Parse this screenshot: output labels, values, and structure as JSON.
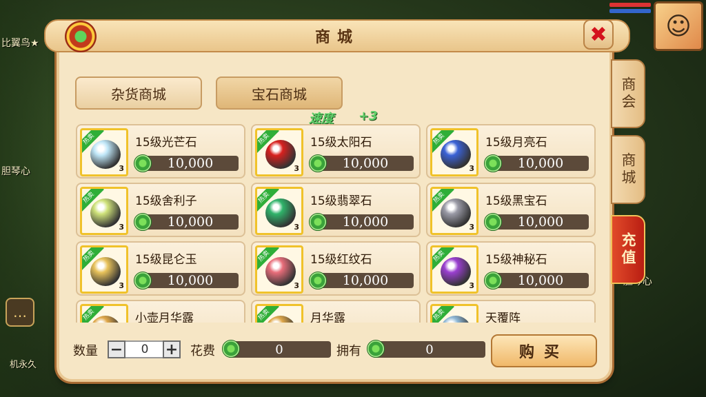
{
  "background": {
    "player_names": [
      "比翼鸟★",
      "胆琴心",
      "胆琴心"
    ],
    "chat_line": "机永久"
  },
  "window": {
    "title": "商城",
    "close_icon": "close-icon"
  },
  "side_tabs": [
    {
      "label": "商会"
    },
    {
      "label": "商城"
    },
    {
      "label": "充值"
    }
  ],
  "category_tabs": [
    {
      "label": "杂货商城"
    },
    {
      "label": "宝石商城"
    }
  ],
  "floating_text": {
    "stat": "速度",
    "bonus": "+3"
  },
  "hot_tag": "热卖",
  "items": [
    {
      "name": "15级光芒石",
      "price": "10,000",
      "count": "3",
      "color": "#bfe6f7"
    },
    {
      "name": "15级太阳石",
      "price": "10,000",
      "count": "3",
      "color": "#d8201e"
    },
    {
      "name": "15级月亮石",
      "price": "10,000",
      "count": "3",
      "color": "#3b62d6"
    },
    {
      "name": "15级舍利子",
      "price": "10,000",
      "count": "3",
      "color": "#cfe27a"
    },
    {
      "name": "15级翡翠石",
      "price": "10,000",
      "count": "3",
      "color": "#2fb36a"
    },
    {
      "name": "15级黑宝石",
      "price": "10,000",
      "count": "3",
      "color": "#9a9aa6"
    },
    {
      "name": "15级昆仑玉",
      "price": "10,000",
      "count": "3",
      "color": "#e8c25a"
    },
    {
      "name": "15级红纹石",
      "price": "10,000",
      "count": "3",
      "color": "#e86d7a"
    },
    {
      "name": "15级神秘石",
      "price": "10,000",
      "count": "3",
      "color": "#9a3fd0"
    },
    {
      "name": "小壶月华露",
      "price": "",
      "count": "",
      "color": "#e0a84a"
    },
    {
      "name": "月华露",
      "price": "",
      "count": "",
      "color": "#e0a84a"
    },
    {
      "name": "天覆阵",
      "price": "",
      "count": "",
      "color": "#8fb8d6"
    }
  ],
  "footer": {
    "quantity_label": "数量",
    "quantity_value": "0",
    "minus": "−",
    "plus": "+",
    "cost_label": "花费",
    "cost_value": "0",
    "owned_label": "拥有",
    "owned_value": "0",
    "buy_label": "购买"
  }
}
